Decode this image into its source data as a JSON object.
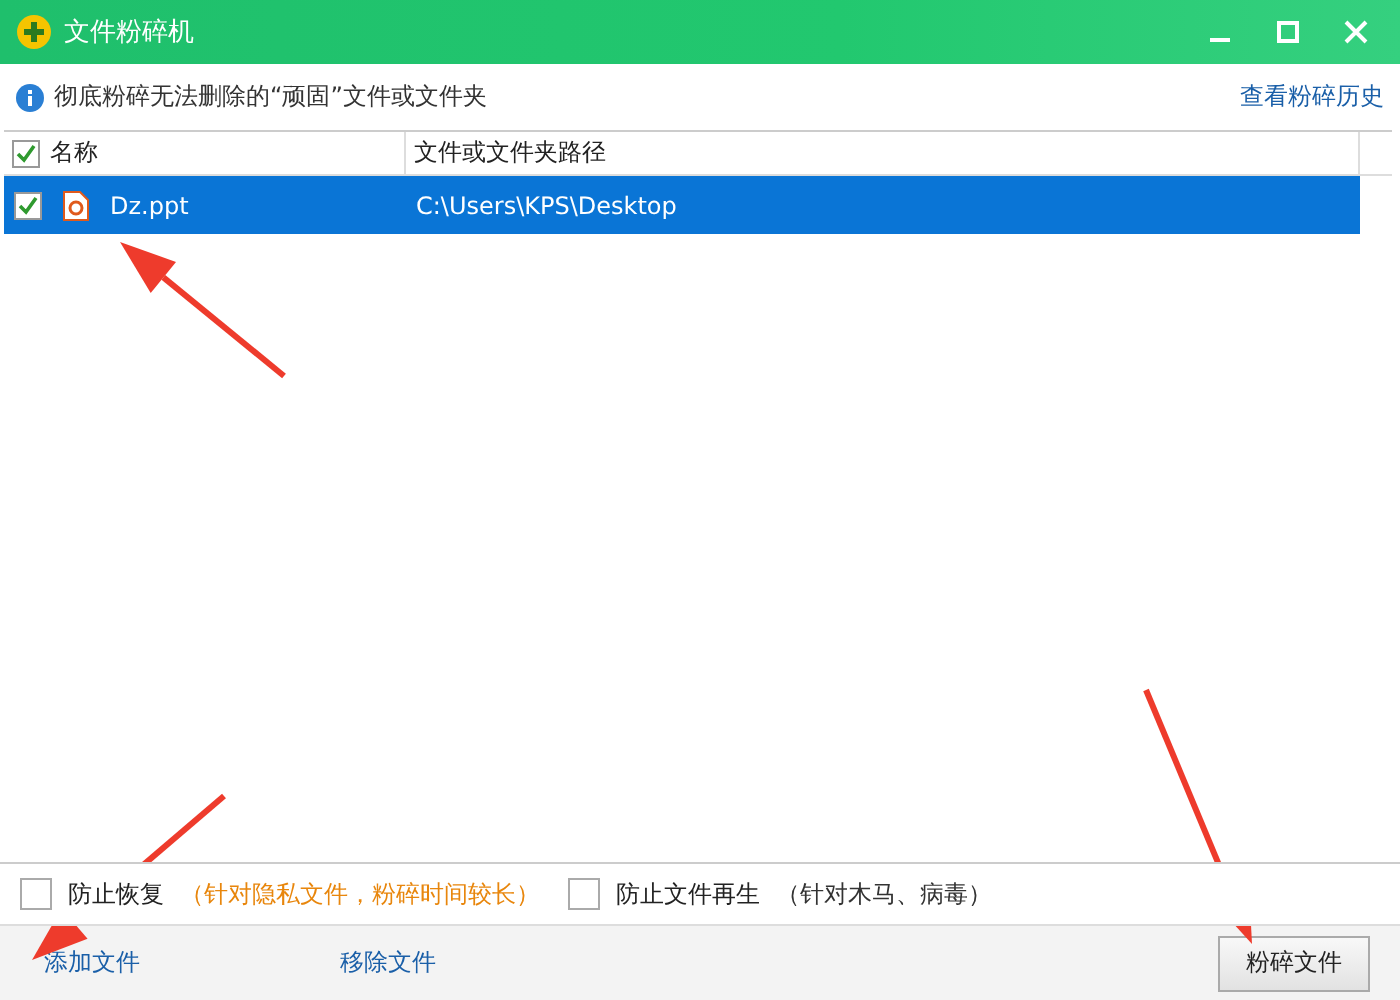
{
  "window": {
    "title": "文件粉碎机"
  },
  "info": {
    "text": "彻底粉碎无法删除的“顽固”文件或文件夹",
    "link": "查看粉碎历史"
  },
  "table": {
    "all_checked": true,
    "columns": [
      "名称",
      "文件或文件夹路径"
    ],
    "rows": [
      {
        "name": "Dz.ppt",
        "path": "C:\\Users\\KPS\\Desktop",
        "checked": true,
        "selected": true
      }
    ]
  },
  "options": [
    {
      "label": "防止恢复",
      "note": "（针对隐私文件，粉碎时间较长）",
      "highlight": true,
      "checked": false
    },
    {
      "label": "防止文件再生",
      "note": "（针对木马、病毒）",
      "highlight": false,
      "checked": false
    }
  ],
  "actions": [
    {
      "label": "添加文件"
    },
    {
      "label": "移除文件"
    }
  ],
  "primary_button": "粉碎文件",
  "annotations": [
    {
      "kind": "arrow"
    },
    {
      "kind": "arrow"
    },
    {
      "kind": "arrow"
    }
  ]
}
